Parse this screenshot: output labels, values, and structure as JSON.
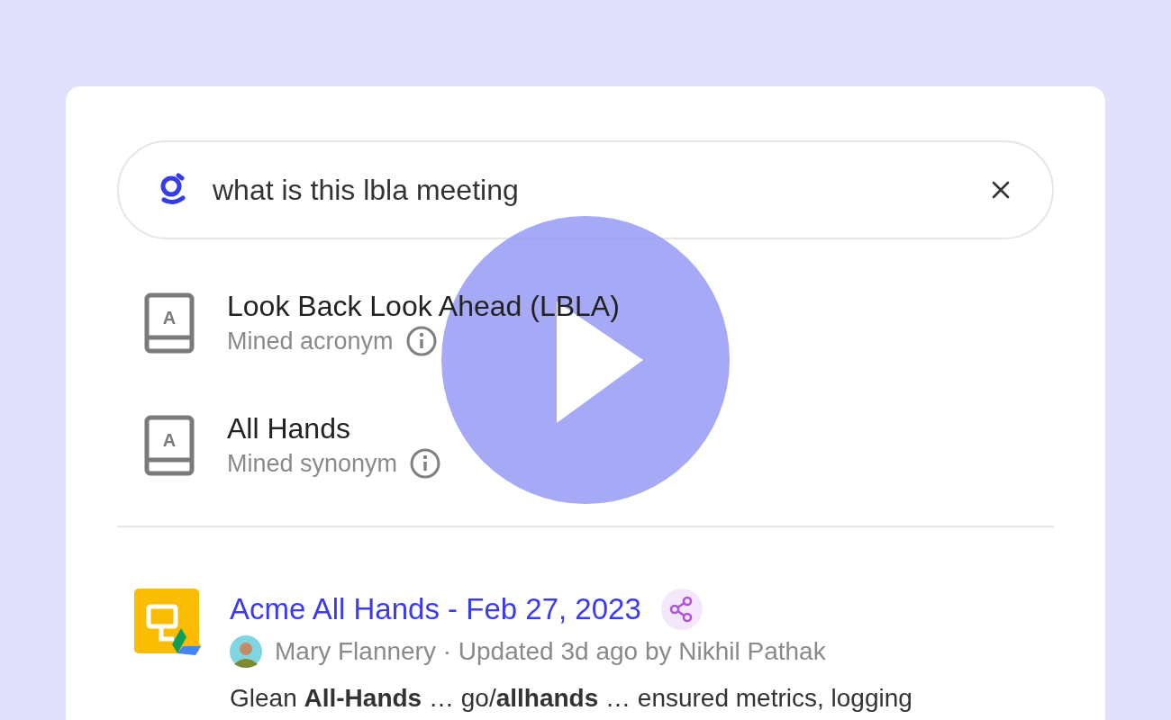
{
  "search": {
    "value": "what is this lbla meeting"
  },
  "suggestions": [
    {
      "icon_letter": "A",
      "title": "Look Back Look Ahead (LBLA)",
      "subtitle": "Mined acronym"
    },
    {
      "icon_letter": "A",
      "title": "All Hands",
      "subtitle": "Mined synonym"
    }
  ],
  "results": [
    {
      "title": "Acme All Hands - Feb 27, 2023",
      "meta": "Mary Flannery · Updated 3d ago by Nikhil Pathak",
      "snippet": "Glean **All-Hands** … go/**allhands** … ensured metrics, logging"
    }
  ]
}
